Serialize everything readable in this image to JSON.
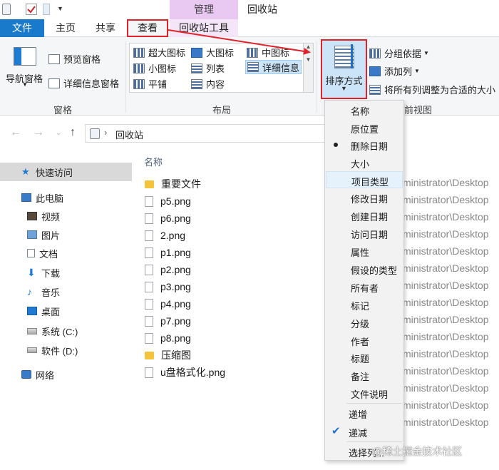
{
  "window": {
    "title": "回收站",
    "context_tab_group": "管理",
    "accent_color": "#1979ca",
    "highlight_color": "#e0222a"
  },
  "tabs": {
    "file": "文件",
    "home": "主页",
    "share": "共享",
    "view": "查看",
    "recycle_tools": "回收站工具"
  },
  "ribbon": {
    "panes": {
      "nav_pane": "导航窗格",
      "preview_pane": "预览窗格",
      "details_pane": "详细信息窗格",
      "group": "窗格"
    },
    "layout": {
      "extra_large": "超大图标",
      "large": "大图标",
      "medium": "中图标",
      "small": "小图标",
      "list": "列表",
      "details": "详细信息",
      "tiles": "平铺",
      "content": "内容",
      "group": "布局"
    },
    "current_view": {
      "sort_by": "排序方式",
      "group_by": "分组依据",
      "add_column": "添加列",
      "fit_columns": "将所有列调整为合适的大小",
      "group": "前视图"
    }
  },
  "address": {
    "path": "回收站"
  },
  "sidebar": {
    "items": [
      {
        "label": "快速访问",
        "icon": "star-icon"
      },
      {
        "label": "此电脑",
        "icon": "computer-icon"
      },
      {
        "label": "视频",
        "icon": "video-icon"
      },
      {
        "label": "图片",
        "icon": "picture-icon"
      },
      {
        "label": "文档",
        "icon": "document-icon"
      },
      {
        "label": "下载",
        "icon": "download-icon"
      },
      {
        "label": "音乐",
        "icon": "music-icon"
      },
      {
        "label": "桌面",
        "icon": "desktop-icon"
      },
      {
        "label": "系统 (C:)",
        "icon": "drive-c-icon"
      },
      {
        "label": "软件 (D:)",
        "icon": "drive-d-icon"
      },
      {
        "label": "网络",
        "icon": "network-icon"
      }
    ]
  },
  "filelist": {
    "column_name": "名称",
    "original_location": "ministrator\\Desktop",
    "files": [
      {
        "name": "重要文件",
        "type": "folder"
      },
      {
        "name": "p5.png",
        "type": "file"
      },
      {
        "name": "p6.png",
        "type": "file"
      },
      {
        "name": "2.png",
        "type": "file"
      },
      {
        "name": "p1.png",
        "type": "file"
      },
      {
        "name": "p2.png",
        "type": "file"
      },
      {
        "name": "p3.png",
        "type": "file"
      },
      {
        "name": "p4.png",
        "type": "file"
      },
      {
        "name": "p7.png",
        "type": "file"
      },
      {
        "name": "p8.png",
        "type": "file"
      },
      {
        "name": "压缩图",
        "type": "folder"
      },
      {
        "name": "u盘格式化.png",
        "type": "file"
      }
    ]
  },
  "sort_menu": {
    "items": [
      "名称",
      "原位置",
      "删除日期",
      "大小",
      "项目类型",
      "修改日期",
      "创建日期",
      "访问日期",
      "属性",
      "假设的类型",
      "所有者",
      "标记",
      "分级",
      "作者",
      "标题",
      "备注",
      "文件说明"
    ],
    "selected": "删除日期",
    "hovered": "项目类型",
    "ascending": "递增",
    "descending": "递减",
    "order_selected": "递减",
    "choose_columns": "选择列..."
  },
  "watermark": "@稀土掘金技术社区"
}
